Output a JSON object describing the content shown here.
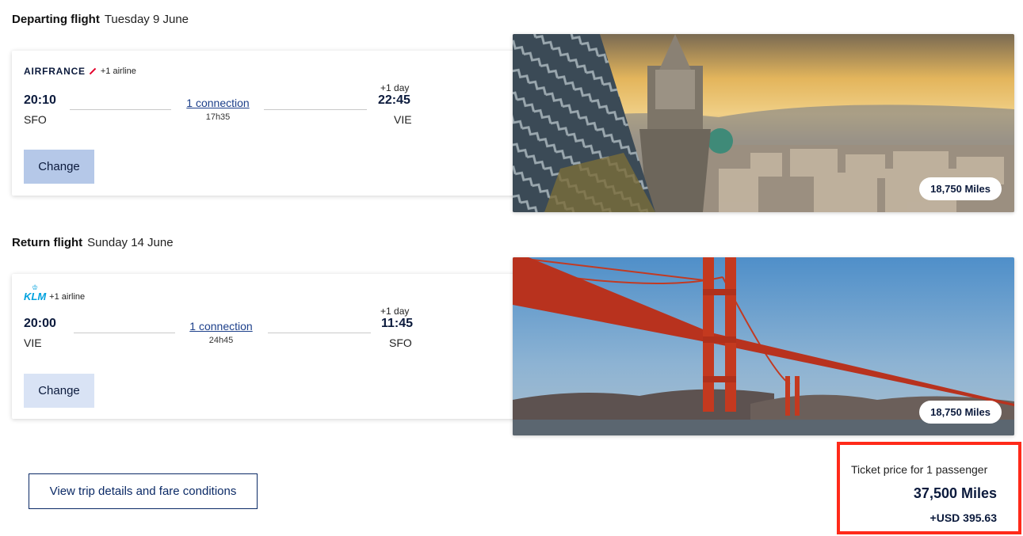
{
  "departing": {
    "title": "Departing flight",
    "date": "Tuesday 9 June",
    "airline_logo": "AIRFRANCE",
    "additional_airlines": "+1 airline",
    "dep_time": "20:10",
    "dep_airport": "SFO",
    "connection": "1 connection",
    "duration": "17h35",
    "plus_day": "+1 day",
    "arr_time": "22:45",
    "arr_airport": "VIE",
    "change_label": "Change",
    "miles": "18,750 Miles",
    "photo_subject": "vienna-cathedral-skyline"
  },
  "return": {
    "title": "Return flight",
    "date": "Sunday 14 June",
    "airline_logo": "KLM",
    "additional_airlines": "+1 airline",
    "dep_time": "20:00",
    "dep_airport": "VIE",
    "connection": "1 connection",
    "duration": "24h45",
    "plus_day": "+1 day",
    "arr_time": "11:45",
    "arr_airport": "SFO",
    "change_label": "Change",
    "miles": "18,750 Miles",
    "photo_subject": "golden-gate-bridge"
  },
  "details_button": "View trip details and fare conditions",
  "price": {
    "label": "Ticket price for 1 passenger",
    "miles": "37,500 Miles",
    "usd": "+USD 395.63"
  },
  "colors": {
    "brand_navy": "#0b1a3c",
    "link_blue": "#1c3f8a",
    "change_selected": "#b5c8e8",
    "change_default": "#d9e3f5",
    "highlight_red": "#ff2a1a"
  }
}
